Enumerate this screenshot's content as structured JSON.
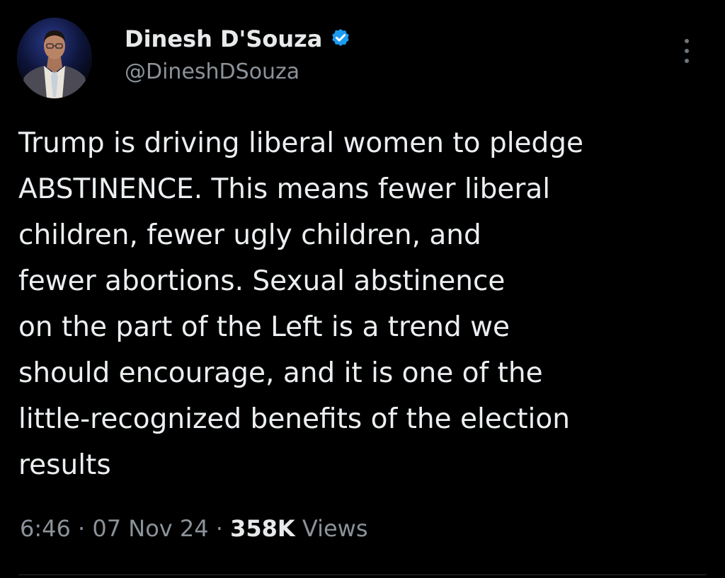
{
  "author": {
    "display_name": "Dinesh D'Souza",
    "handle": "@DineshDSouza",
    "verified": true,
    "avatar_icon": "profile-photo",
    "verified_icon": "verified-badge-icon",
    "verified_color": "#1d9bf0"
  },
  "menu": {
    "more_icon": "vertical-ellipsis-icon"
  },
  "tweet": {
    "lines": [
      "Trump is driving liberal women to pledge",
      "ABSTINENCE. This means fewer liberal",
      "children, fewer ugly children, and",
      "fewer abortions. Sexual abstinence",
      "on the part of the Left is a trend we",
      "should encourage, and it is one of the",
      "little-recognized benefits of the election",
      "results"
    ]
  },
  "meta": {
    "time": "6:46",
    "separator": "·",
    "date": "07 Nov 24",
    "views_count": "358K",
    "views_label": "Views"
  },
  "colors": {
    "background": "#000000",
    "primary_text": "#e7e9ea",
    "secondary_text": "#8b9299"
  }
}
